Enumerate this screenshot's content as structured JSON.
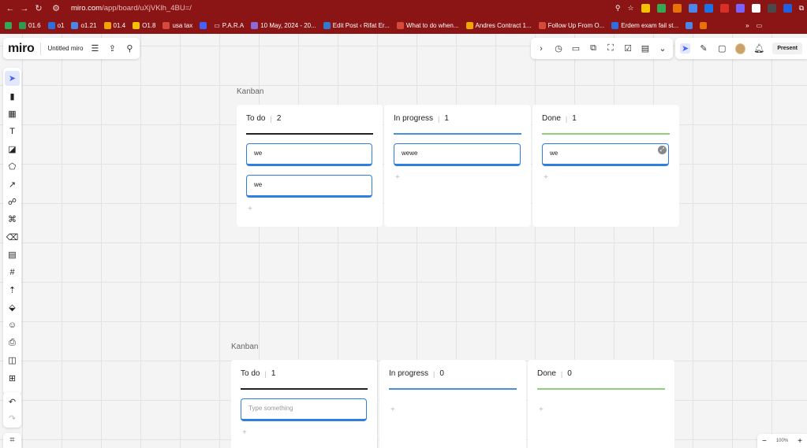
{
  "browser": {
    "url_host": "miro.com",
    "url_path": "/app/board/uXjVKlh_4BU=/",
    "bookmarks": [
      {
        "label": "01.6",
        "color": "#2e9b4f"
      },
      {
        "label": "o1",
        "color": "#2d6fe0"
      },
      {
        "label": "o1.21",
        "color": "#4b87e8"
      },
      {
        "label": "01.4",
        "color": "#f0a500"
      },
      {
        "label": "O1.8",
        "color": "#f2c200"
      },
      {
        "label": "usa tax",
        "color": "#d64a3b"
      },
      {
        "label": "",
        "color": "#4262ff"
      },
      {
        "label": "P.A.R.A",
        "color": "#ffffff"
      },
      {
        "label": "10 May, 2024 - 20...",
        "color": "#8c6bd8"
      },
      {
        "label": "Edit Post ‹ Rifat Er...",
        "color": "#2e7bcf"
      },
      {
        "label": "What to do when...",
        "color": "#d64a3b"
      },
      {
        "label": "Andres Contract 1...",
        "color": "#f0a500"
      },
      {
        "label": "Follow Up From O...",
        "color": "#d64a3b"
      },
      {
        "label": "Erdem exam fail st...",
        "color": "#2d6fe0"
      }
    ]
  },
  "miro": {
    "logo": "miro",
    "board_name": "Untitled miro",
    "present_label": "Present",
    "zoom_level": "100%"
  },
  "boards": [
    {
      "title": "Kanban",
      "columns": [
        {
          "name": "To do",
          "count": "2",
          "line_color": "#222222",
          "cards": [
            "we",
            "we"
          ]
        },
        {
          "name": "In progress",
          "count": "1",
          "line_color": "#4a90e2",
          "cards": [
            "wewe"
          ]
        },
        {
          "name": "Done",
          "count": "1",
          "line_color": "#8fd080",
          "cards": [
            "we"
          ]
        }
      ]
    },
    {
      "title": "Kanban",
      "columns": [
        {
          "name": "To do",
          "count": "1",
          "line_color": "#222222",
          "placeholder": "Type something"
        },
        {
          "name": "In progress",
          "count": "0",
          "line_color": "#4a90e2"
        },
        {
          "name": "Done",
          "count": "0",
          "line_color": "#8fd080"
        }
      ]
    }
  ]
}
